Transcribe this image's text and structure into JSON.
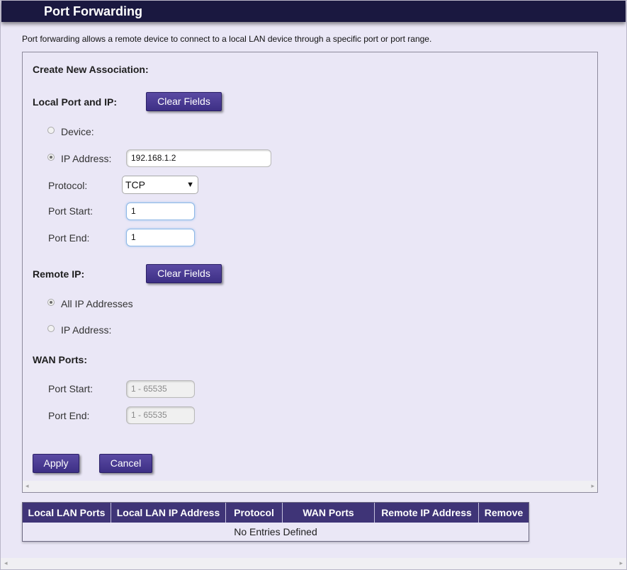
{
  "header": {
    "title": "Port Forwarding"
  },
  "intro": "Port forwarding allows a remote device to connect to a local LAN device through a specific port or port range.",
  "form": {
    "create_heading": "Create New Association:",
    "local": {
      "heading": "Local Port and IP:",
      "clear_label": "Clear Fields",
      "device_label": "Device:",
      "ip_label": "IP Address:",
      "ip_value": "192.168.1.2",
      "protocol_label": "Protocol:",
      "protocol_value": "TCP",
      "port_start_label": "Port Start:",
      "port_start_value": "1",
      "port_end_label": "Port End:",
      "port_end_value": "1"
    },
    "remote": {
      "heading": "Remote IP:",
      "clear_label": "Clear Fields",
      "all_label": "All IP Addresses",
      "ip_label": "IP Address:"
    },
    "wan": {
      "heading": "WAN Ports:",
      "port_start_label": "Port Start:",
      "port_start_placeholder": "1 - 65535",
      "port_end_label": "Port End:",
      "port_end_placeholder": "1 - 65535"
    },
    "apply_label": "Apply",
    "cancel_label": "Cancel"
  },
  "table": {
    "columns": [
      "Local LAN Ports",
      "Local LAN IP Address",
      "Protocol",
      "WAN Ports",
      "Remote IP Address",
      "Remove"
    ],
    "empty_text": "No Entries Defined"
  },
  "icons": {
    "scroll_left": "◂",
    "scroll_right": "▸",
    "dropdown": "▼"
  }
}
